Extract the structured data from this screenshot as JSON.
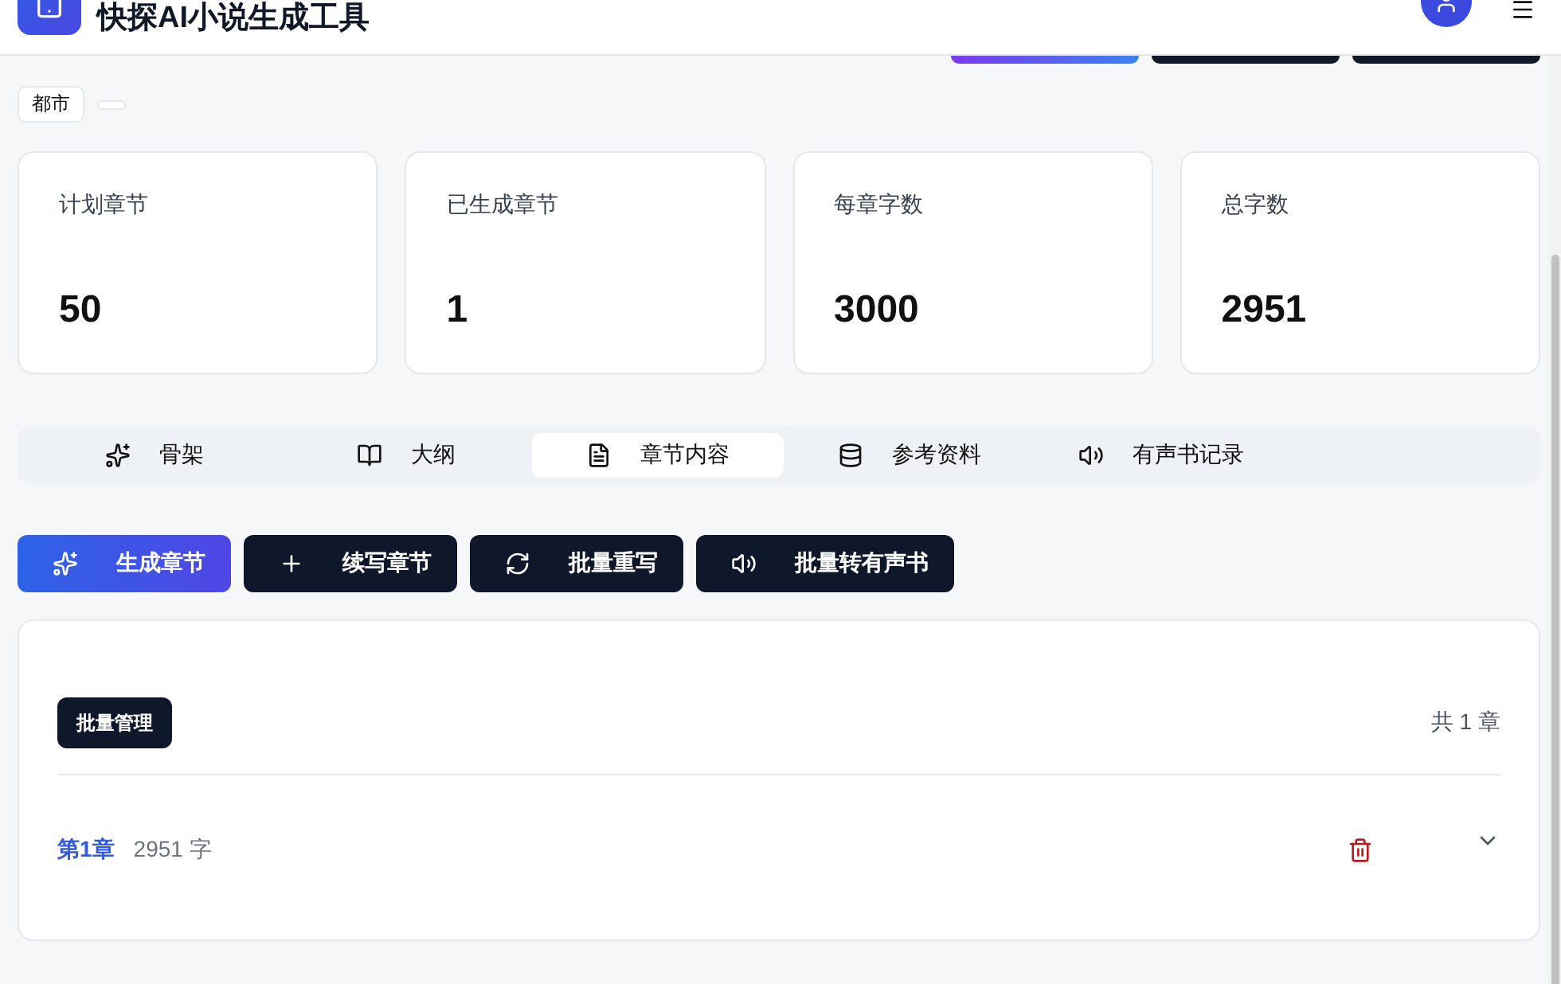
{
  "header": {
    "title": "快探AI小说生成工具"
  },
  "tags": [
    {
      "label": "都市"
    }
  ],
  "stats": [
    {
      "label": "计划章节",
      "value": "50"
    },
    {
      "label": "已生成章节",
      "value": "1"
    },
    {
      "label": "每章字数",
      "value": "3000"
    },
    {
      "label": "总字数",
      "value": "2951"
    }
  ],
  "tabs": [
    {
      "label": "骨架",
      "selected": false
    },
    {
      "label": "大纲",
      "selected": false
    },
    {
      "label": "章节内容",
      "selected": true
    },
    {
      "label": "参考资料",
      "selected": false
    },
    {
      "label": "有声书记录",
      "selected": false
    }
  ],
  "actions": [
    {
      "label": "生成章节",
      "kind": "primary"
    },
    {
      "label": "续写章节",
      "kind": "dark"
    },
    {
      "label": "批量重写",
      "kind": "dark"
    },
    {
      "label": "批量转有声书",
      "kind": "dark"
    }
  ],
  "panel": {
    "batch_button": "批量管理",
    "count": "共 1 章",
    "chapters": [
      {
        "title": "第1章",
        "words": "2951 字",
        "expanded": false
      }
    ]
  }
}
